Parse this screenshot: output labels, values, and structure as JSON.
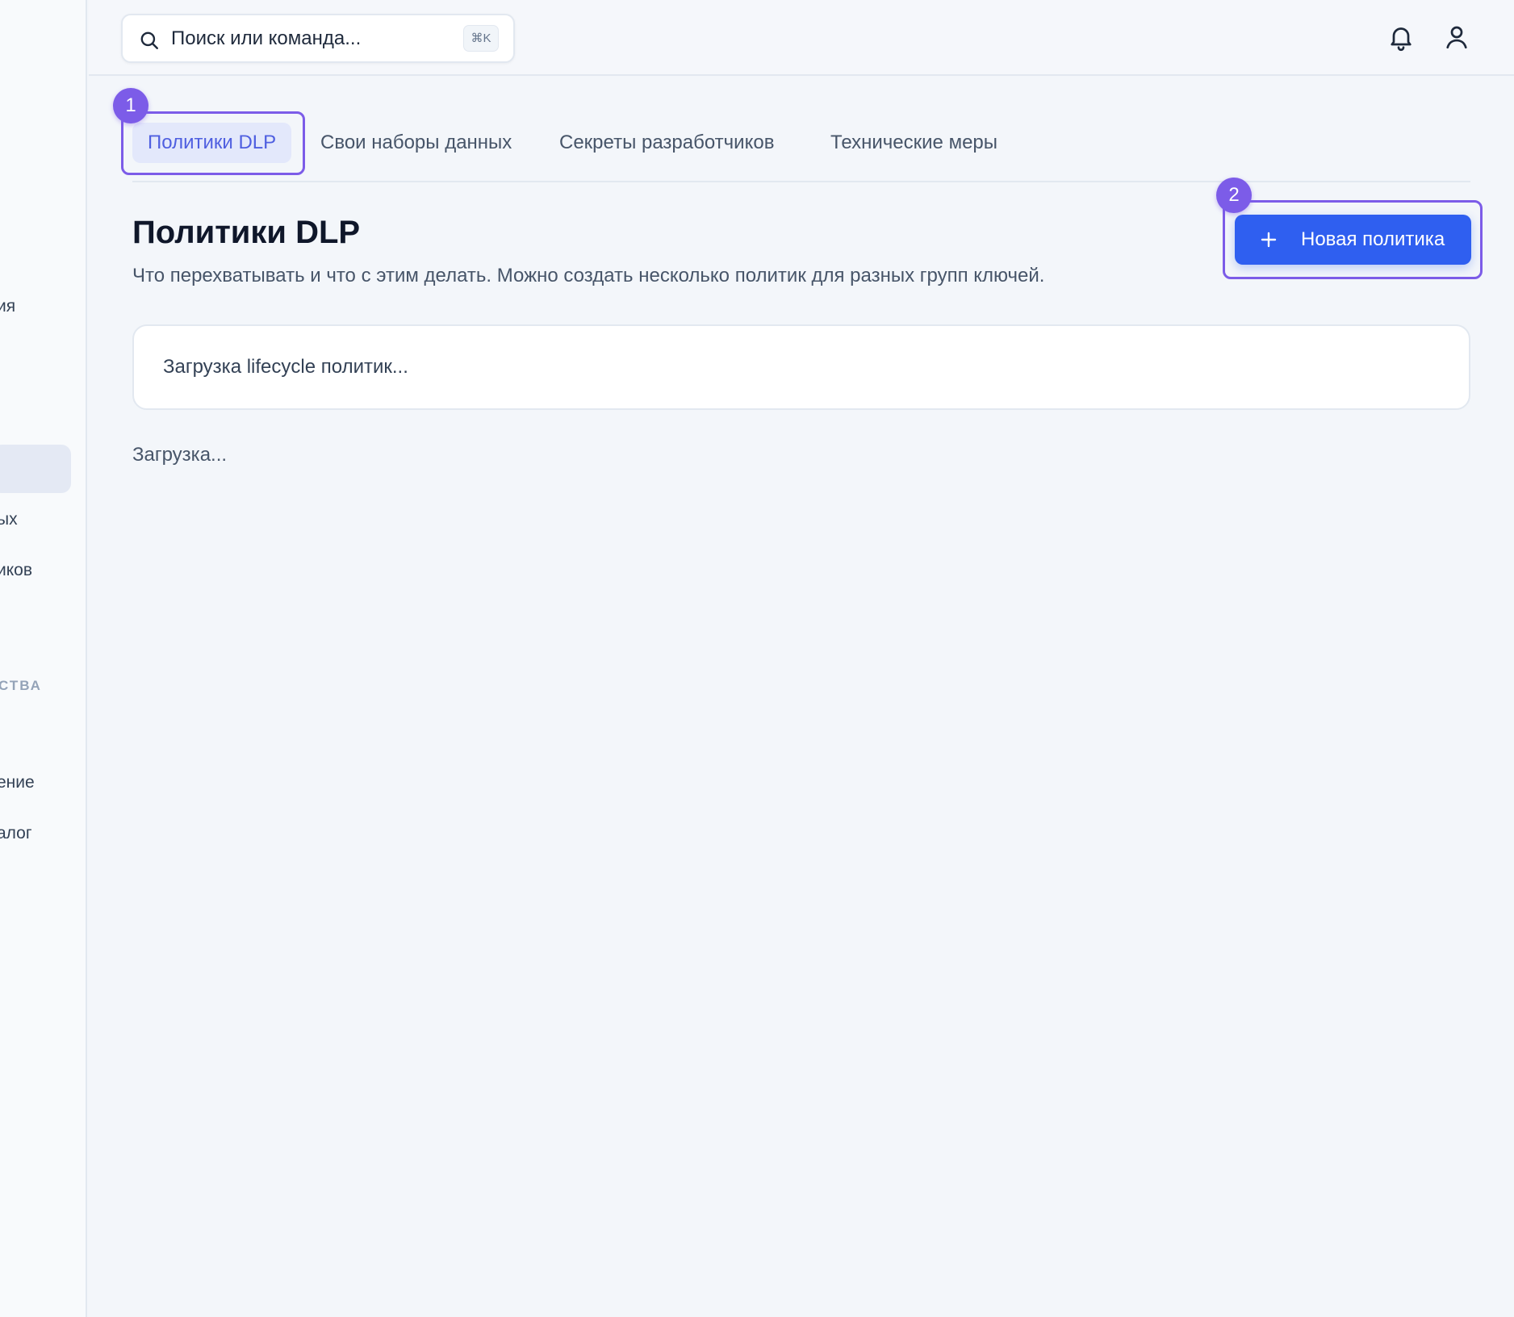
{
  "header": {
    "search_placeholder": "Поиск или команда...",
    "shortcut": "⌘K"
  },
  "sidebar": {
    "items": [
      {
        "label": "ия"
      },
      {
        "label": ""
      },
      {
        "label": "ых"
      },
      {
        "label": "иков"
      },
      {
        "label": "ение"
      },
      {
        "label": "алог"
      }
    ],
    "section_label": "СТВА"
  },
  "tabs": [
    {
      "label": "Политики DLP",
      "active": true
    },
    {
      "label": "Свои наборы данных",
      "active": false
    },
    {
      "label": "Секреты разработчиков",
      "active": false
    },
    {
      "label": "Технические меры",
      "active": false
    }
  ],
  "annotations": [
    "1",
    "2"
  ],
  "page": {
    "title": "Политики DLP",
    "subtitle": "Что перехватывать и что с этим делать. Можно создать несколько политик для разных групп ключей.",
    "new_policy_button": "Новая политика"
  },
  "card": {
    "text": "Загрузка lifecycle политик..."
  },
  "loading_text": "Загрузка...",
  "colors": {
    "primary": "#2f5ff0",
    "annotation": "#7c5ce8",
    "active_tab_text": "#4f5fe0",
    "active_tab_bg": "#e3e8fb"
  }
}
